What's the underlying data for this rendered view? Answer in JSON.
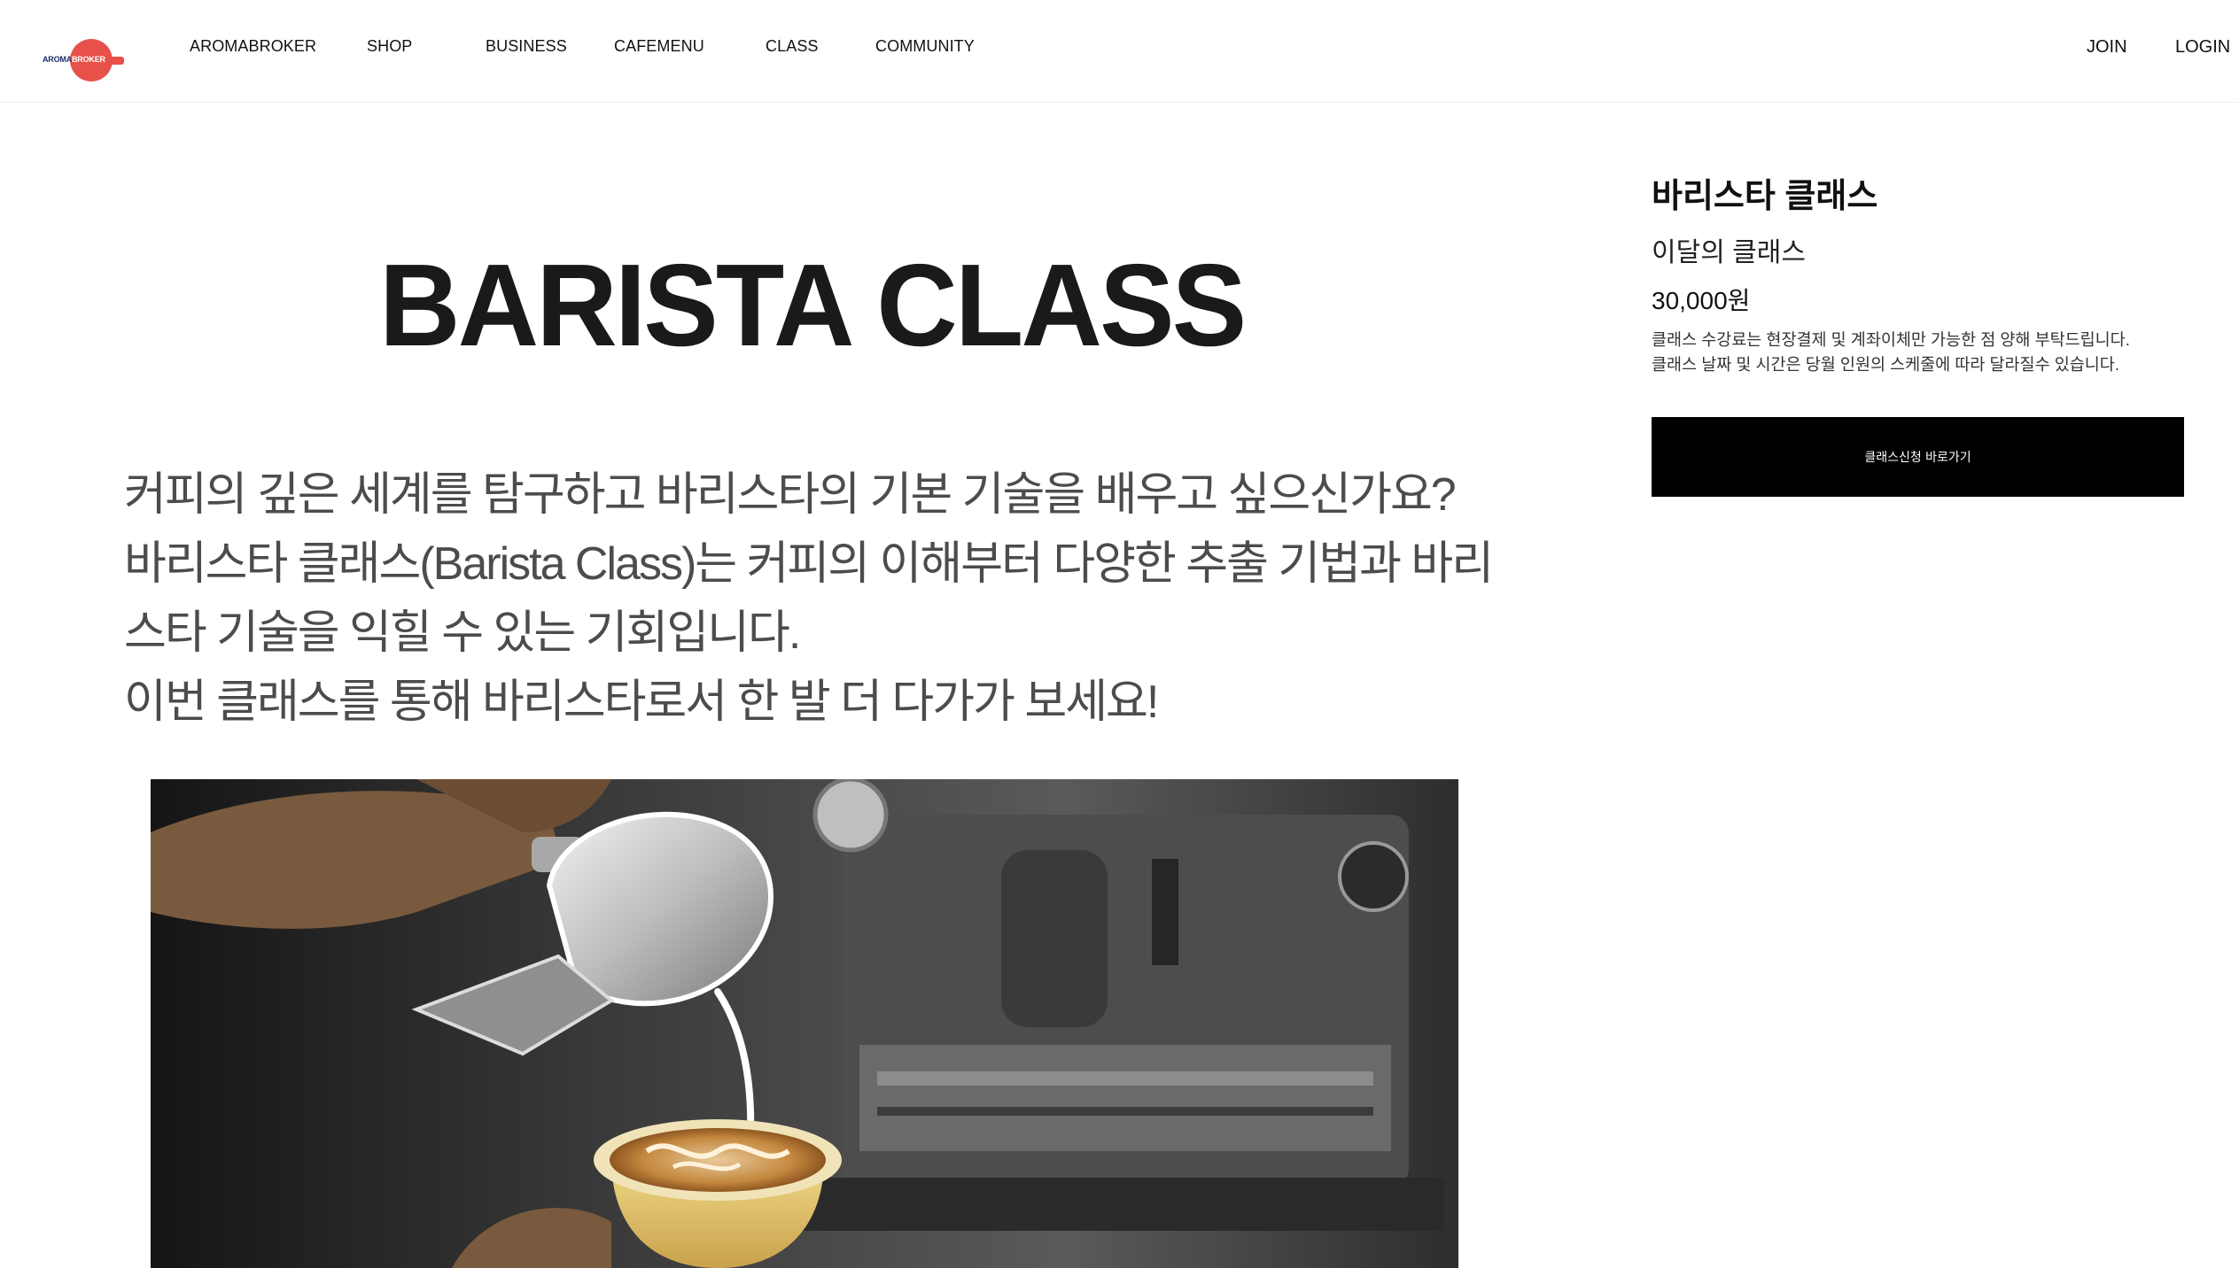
{
  "brand": {
    "logo_text_a": "AROMA",
    "logo_text_b": "BROKER",
    "logo_color": "#e8504a",
    "logo_text_color": "#1d2f6b"
  },
  "nav": {
    "items": [
      {
        "label": "AROMABROKER"
      },
      {
        "label": "SHOP"
      },
      {
        "label": "BUSINESS"
      },
      {
        "label": "CAFEMENU"
      },
      {
        "label": "CLASS"
      },
      {
        "label": "COMMUNITY"
      }
    ]
  },
  "auth": {
    "join": "JOIN",
    "login": "LOGIN"
  },
  "main": {
    "hero_title": "BARISTA CLASS",
    "intro_lines": [
      "커피의 깊은 세계를 탐구하고 바리스타의 기본 기술을 배우고 싶으신가요?",
      "바리스타 클래스(Barista Class)는 커피의 이해부터 다양한 추출 기법과 바리",
      "스타 기술을 익힐 수 있는 기회입니다.",
      "이번 클래스를 통해 바리스타로서 한 발 더 다가가 보세요!"
    ]
  },
  "product": {
    "title": "바리스타 클래스",
    "subtitle": "이달의 클래스",
    "price": "30,000원",
    "notes": [
      "클래스 수강료는 현장결제 및 계좌이체만 가능한 점 양해 부탁드립니다.",
      "클래스 날짜 및 시간은 당월 인원의 스케줄에 따라 달라질수 있습니다."
    ],
    "cta_label": "클래스신청 바로가기"
  },
  "colors": {
    "cta_bg": "#000000",
    "cta_text": "#ffffff",
    "intro_text": "#4c4c4c"
  }
}
